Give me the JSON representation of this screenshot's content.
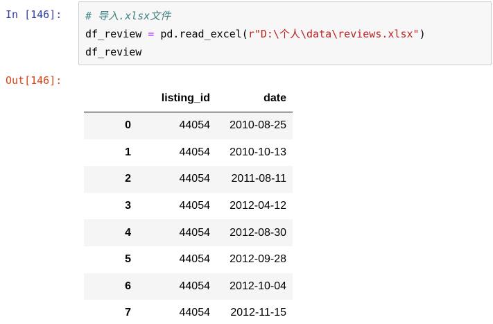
{
  "input_prompt": "In [146]:",
  "output_prompt": "Out[146]:",
  "code": {
    "comment": "# 导入.xlsx文件",
    "line2_var": "df_review",
    "line2_op": " = ",
    "line2_call": "pd.read_excel(",
    "line2_str": "r\"D:\\个人\\data\\reviews.xlsx\"",
    "line2_close": ")",
    "line3": "df_review"
  },
  "table": {
    "columns": [
      "",
      "listing_id",
      "date"
    ],
    "rows": [
      {
        "index": "0",
        "listing_id": "44054",
        "date": "2010-08-25"
      },
      {
        "index": "1",
        "listing_id": "44054",
        "date": "2010-10-13"
      },
      {
        "index": "2",
        "listing_id": "44054",
        "date": "2011-08-11"
      },
      {
        "index": "3",
        "listing_id": "44054",
        "date": "2012-04-12"
      },
      {
        "index": "4",
        "listing_id": "44054",
        "date": "2012-08-30"
      },
      {
        "index": "5",
        "listing_id": "44054",
        "date": "2012-09-28"
      },
      {
        "index": "6",
        "listing_id": "44054",
        "date": "2012-10-04"
      },
      {
        "index": "7",
        "listing_id": "44054",
        "date": "2012-11-15"
      }
    ]
  }
}
